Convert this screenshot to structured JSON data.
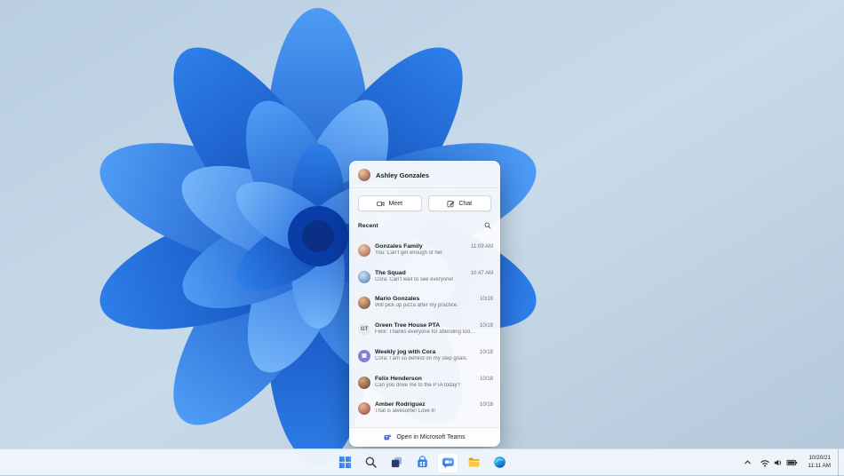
{
  "colors": {
    "accent_blue": "#2b6de8",
    "teams_blue": "#4b53bc",
    "taskbar_bg": "#f0f5fa",
    "bloom_dark": "#0a3da8",
    "bloom_light": "#5ea7f5"
  },
  "chat_panel": {
    "user": {
      "name": "Ashley Gonzales",
      "avatar_bg": "radial-gradient(circle at 35% 30%, #f2c6a0, #7e4a34)"
    },
    "actions": {
      "meet_label": "Meet",
      "chat_label": "Chat"
    },
    "recent_label": "Recent",
    "conversations": [
      {
        "name": "Gonzales Family",
        "preview": "You: Can't get enough of her.",
        "time": "11:09 AM",
        "avatar_text": "",
        "avatar_fg": "#ffffff",
        "avatar_bg": "radial-gradient(circle at 35% 30%, #f0c8a8, #9c5f46)"
      },
      {
        "name": "The Squad",
        "preview": "Cora: Can't wait to see everyone!",
        "time": "10:47 AM",
        "avatar_text": "",
        "avatar_fg": "#ffffff",
        "avatar_bg": "radial-gradient(circle at 40% 35%, #cfe3f2, #4a78a8)"
      },
      {
        "name": "Mario Gonzales",
        "preview": "Will pick up pizza after my practice.",
        "time": "10/19",
        "avatar_text": "",
        "avatar_fg": "#ffffff",
        "avatar_bg": "radial-gradient(circle at 35% 30%, #e8b88e, #6e4630)"
      },
      {
        "name": "Green Tree House PTA",
        "preview": "Felix: Thanks everyone for attending today.",
        "time": "10/19",
        "avatar_text": "GT",
        "avatar_fg": "#5a5a5a",
        "avatar_bg": "#e9e9ec"
      },
      {
        "name": "Weekly jog with Cora",
        "preview": "Cora: I am so behind on my step goals.",
        "time": "10/18",
        "avatar_text": "▦",
        "avatar_fg": "#ffffff",
        "avatar_bg": "#8b7cd8"
      },
      {
        "name": "Felix Henderson",
        "preview": "Can you drive me to the PTA today?",
        "time": "10/18",
        "avatar_text": "",
        "avatar_fg": "#ffffff",
        "avatar_bg": "radial-gradient(circle at 35% 30%, #d8a87e, #5f3d2a)"
      },
      {
        "name": "Amber Rodriguez",
        "preview": "That is awesome! Love it!",
        "time": "10/18",
        "avatar_text": "",
        "avatar_fg": "#ffffff",
        "avatar_bg": "radial-gradient(circle at 35% 30%, #f0b49a, #8a4836)"
      }
    ],
    "footer_label": "Open in Microsoft Teams"
  },
  "taskbar": {
    "icons": [
      "start",
      "search",
      "task-view",
      "store",
      "chat",
      "file-explorer",
      "edge"
    ],
    "active_icon": "chat",
    "tray_icons": [
      "chevron-up",
      "network",
      "volume",
      "battery"
    ],
    "clock": {
      "date": "10/20/21",
      "time": "11:11 AM"
    }
  }
}
